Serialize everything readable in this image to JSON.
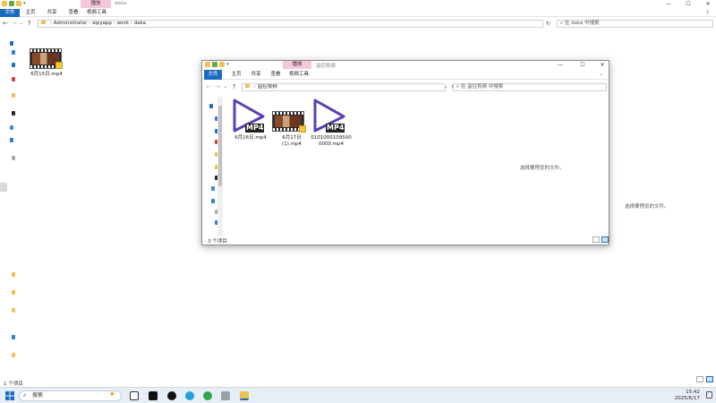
{
  "bg_window": {
    "title": "daka",
    "context_tab": "播放",
    "ribbon_tabs": [
      "文件",
      "主页",
      "共享",
      "查看",
      "视频工具"
    ],
    "address_path": [
      "Administrator",
      "aipyapp",
      "work",
      "daka"
    ],
    "search_placeholder": "在 daka 中搜索",
    "status": "1 个项目",
    "preview_message": "选择要预览的文件。",
    "files": [
      {
        "name": "6月15日.mp4",
        "type": "video-thumbnail"
      }
    ]
  },
  "fg_window": {
    "title": "监控视频",
    "context_tab": "播放",
    "ribbon_tabs": [
      "文件",
      "主页",
      "共享",
      "查看",
      "视频工具"
    ],
    "address_path": [
      "监控视频"
    ],
    "search_placeholder": "在 监控视频 中搜索",
    "status": "3 个项目",
    "preview_message": "选择要预览的文件。",
    "files": [
      {
        "name_line1": "6月16日.mp4",
        "name_line2": "",
        "type": "mp4-icon"
      },
      {
        "name_line1": "6月17日",
        "name_line2": "(1).mp4",
        "type": "video-thumbnail"
      },
      {
        "name_line1": "0101000109500",
        "name_line2": "0000.mp4",
        "type": "mp4-icon"
      }
    ],
    "mp4_badge": "MP4"
  },
  "window_controls": {
    "minimize": "—",
    "maximize": "☐",
    "close": "✕"
  },
  "taskbar": {
    "search_label": "搜索",
    "time": "15:42",
    "date": "2025/6/17"
  },
  "colors": {
    "accent": "#1a6bbf",
    "context_tab": "#f6c7dc",
    "mp4_play": "#5b3fb3"
  }
}
